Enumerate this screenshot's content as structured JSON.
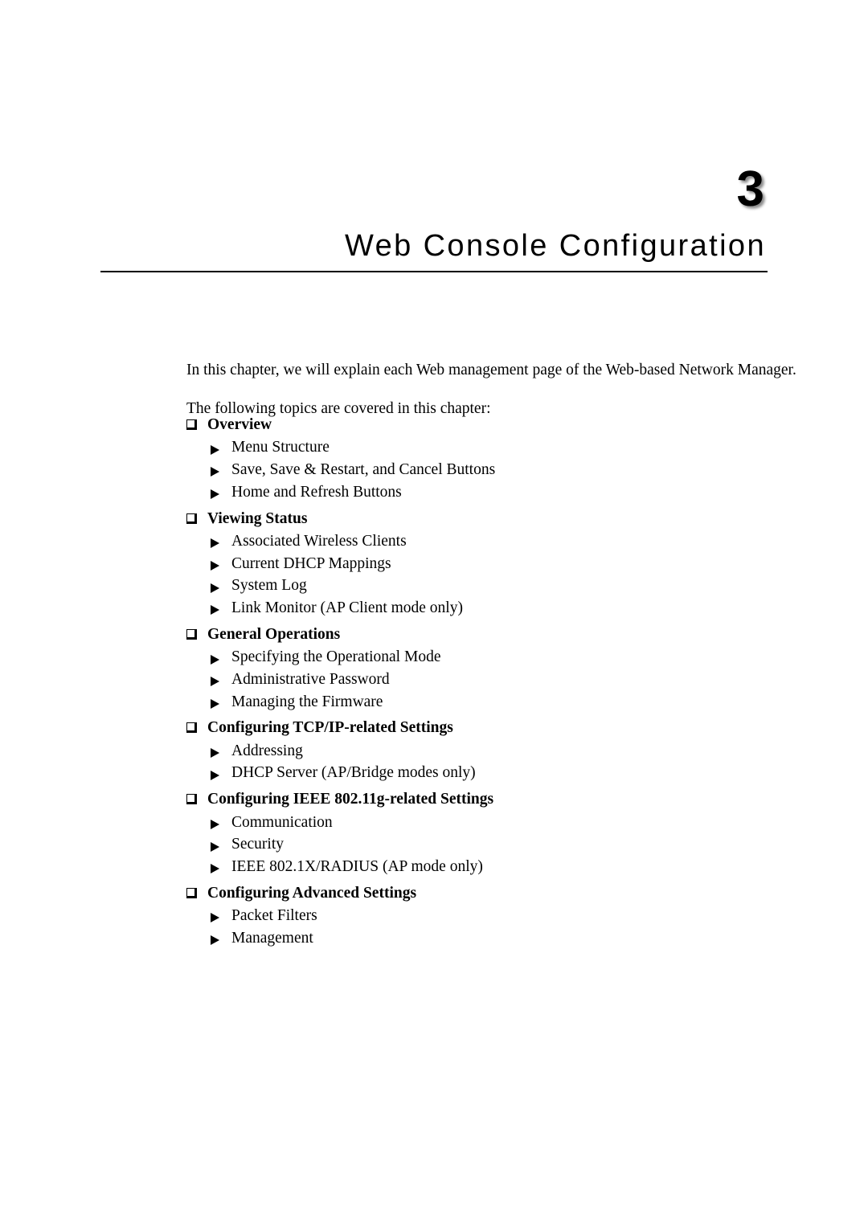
{
  "chapter": {
    "number": "3",
    "title": "Web Console Configuration"
  },
  "intro": {
    "paragraph_1": "In this chapter, we will explain each Web management page of the Web-based Network Manager.",
    "paragraph_2": "The following topics are covered in this chapter:"
  },
  "bullets": {
    "heading_glyph": "square-outline-bullet",
    "sub_glyph": "arrowhead-bullet"
  },
  "topics": [
    {
      "heading": "Overview",
      "items": [
        "Menu Structure",
        "Save, Save & Restart, and Cancel Buttons",
        "Home and Refresh Buttons"
      ]
    },
    {
      "heading": "Viewing Status",
      "items": [
        "Associated Wireless Clients",
        "Current DHCP Mappings",
        "System Log",
        "Link Monitor (AP Client mode only)"
      ]
    },
    {
      "heading": "General Operations",
      "items": [
        "Specifying the Operational Mode",
        "Administrative Password",
        "Managing the Firmware"
      ]
    },
    {
      "heading": "Configuring TCP/IP-related Settings",
      "items": [
        "Addressing",
        "DHCP Server (AP/Bridge modes only)"
      ]
    },
    {
      "heading": "Configuring IEEE 802.11g-related Settings",
      "items": [
        "Communication",
        "Security",
        "IEEE 802.1X/RADIUS (AP mode only)"
      ]
    },
    {
      "heading": "Configuring Advanced Settings",
      "items": [
        "Packet Filters",
        "Management"
      ]
    }
  ]
}
